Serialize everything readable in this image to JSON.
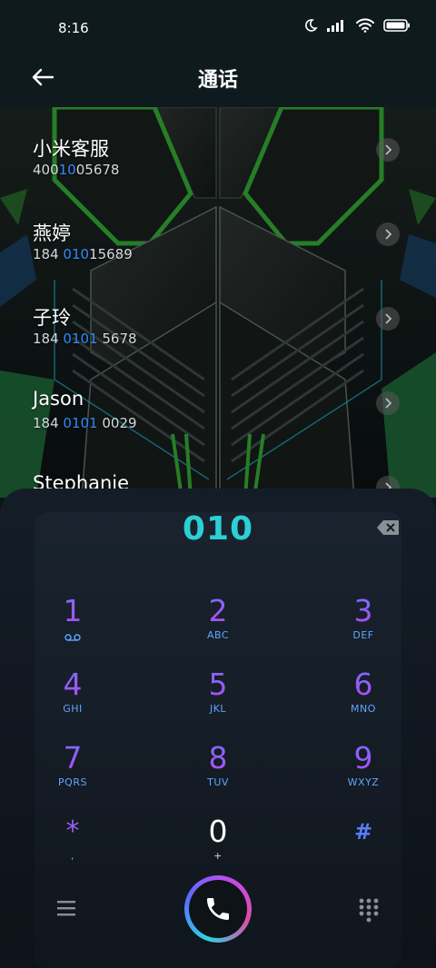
{
  "status_bar": {
    "time": "8:16"
  },
  "header": {
    "title": "通话"
  },
  "contacts": [
    {
      "name": "小米客服",
      "num_pre": "400",
      "num_hl": "10",
      "num_post": "05678"
    },
    {
      "name": "燕婷",
      "num_pre": "184 ",
      "num_hl": "010",
      "num_post": "15689"
    },
    {
      "name": "子玲",
      "num_pre": "184 ",
      "num_hl": "0101",
      "num_post": " 5678"
    },
    {
      "name": "Jason",
      "num_pre": "184 ",
      "num_hl": "0101",
      "num_post": " 0029"
    },
    {
      "name": "Stephanie",
      "num_pre": "",
      "num_hl": "",
      "num_post": ""
    }
  ],
  "dialer": {
    "typed_number": "010",
    "keys": [
      {
        "digit": "1",
        "letters": ""
      },
      {
        "digit": "2",
        "letters": "ABC"
      },
      {
        "digit": "3",
        "letters": "DEF"
      },
      {
        "digit": "4",
        "letters": "GHI"
      },
      {
        "digit": "5",
        "letters": "JKL"
      },
      {
        "digit": "6",
        "letters": "MNO"
      },
      {
        "digit": "7",
        "letters": "PQRS"
      },
      {
        "digit": "8",
        "letters": "TUV"
      },
      {
        "digit": "9",
        "letters": "WXYZ"
      },
      {
        "digit": "*",
        "letters": ","
      },
      {
        "digit": "0",
        "letters": "+"
      },
      {
        "digit": "#",
        "letters": ""
      }
    ]
  },
  "icons": {
    "back": "arrow-left-icon",
    "voicemail": "voicemail-icon",
    "delete": "backspace-icon",
    "call": "phone-icon",
    "menu": "menu-icon",
    "keypad": "keypad-icon"
  },
  "colors": {
    "accent_cyan": "#2ad0d6",
    "highlight_blue": "#2e8cff",
    "digit_purple": "#9b5cf5"
  }
}
